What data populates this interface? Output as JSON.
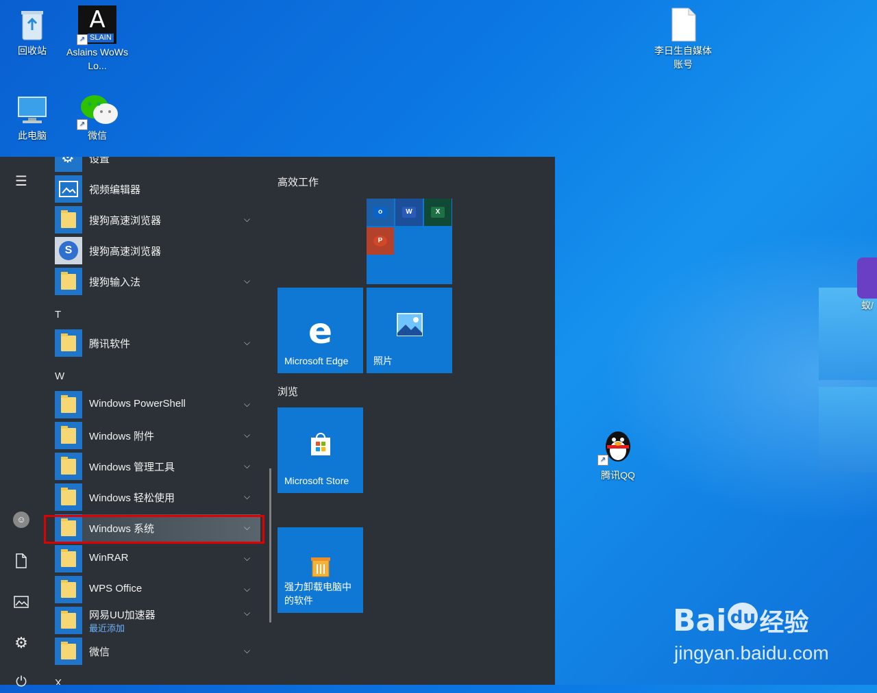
{
  "desktop": {
    "icons": [
      {
        "label": "回收站"
      },
      {
        "label": "Aslains WoWs Lo...",
        "badge": "SLAIN",
        "letter": "A"
      },
      {
        "label": "此电脑"
      },
      {
        "label": "微信"
      },
      {
        "label": "李日生自媒体账号"
      },
      {
        "label": "腾讯QQ"
      },
      {
        "label": "蚁/"
      }
    ]
  },
  "start_menu": {
    "apps": [
      {
        "label": "设置"
      },
      {
        "label": "视频编辑器"
      },
      {
        "label": "搜狗高速浏览器"
      },
      {
        "label": "搜狗高速浏览器"
      },
      {
        "label": "搜狗输入法"
      },
      {
        "label": "腾讯软件"
      },
      {
        "label": "Windows PowerShell"
      },
      {
        "label": "Windows 附件"
      },
      {
        "label": "Windows 管理工具"
      },
      {
        "label": "Windows 轻松使用"
      },
      {
        "label": "Windows 系统"
      },
      {
        "label": "WinRAR"
      },
      {
        "label": "WPS Office"
      },
      {
        "label": "网易UU加速器",
        "sub": "最近添加"
      },
      {
        "label": "微信"
      }
    ],
    "letters": [
      "T",
      "W",
      "X"
    ],
    "groups": {
      "productivity": "高效工作",
      "browse": "浏览"
    },
    "tiles": {
      "edge": "Microsoft Edge",
      "photos": "照片",
      "store": "Microsoft Store",
      "uninstall": "强力卸载电脑中的软件"
    }
  },
  "watermark": {
    "brand": "Bai",
    "brand2": "du",
    "cn": "经验",
    "url": "jingyan.baidu.com"
  }
}
